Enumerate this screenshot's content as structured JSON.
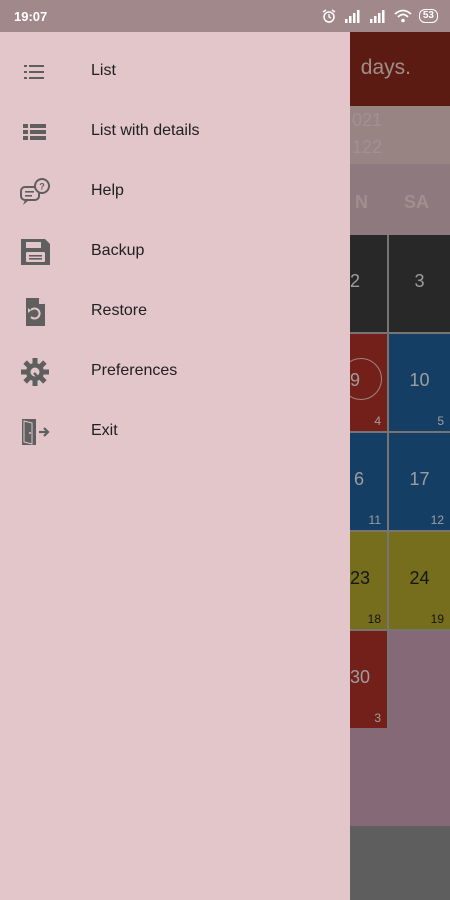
{
  "status_bar": {
    "time": "19:07",
    "battery": "53"
  },
  "app": {
    "title_fragment": "days.",
    "month_line1": "021",
    "month_line2": "122",
    "weekdays": [
      "N",
      "SA"
    ],
    "calendar": [
      {
        "num": "2",
        "sub": ""
      },
      {
        "num": "3",
        "sub": ""
      },
      {
        "num": "9",
        "sub": "4"
      },
      {
        "num": "10",
        "sub": "5"
      },
      {
        "num": "6",
        "sub": "11"
      },
      {
        "num": "17",
        "sub": "12"
      },
      {
        "num": "23",
        "sub": "18"
      },
      {
        "num": "24",
        "sub": "19"
      },
      {
        "num": "30",
        "sub": "3"
      }
    ]
  },
  "drawer": {
    "items": [
      {
        "label": "List",
        "icon": "list-icon"
      },
      {
        "label": "List with details",
        "icon": "list-details-icon"
      },
      {
        "label": "Help",
        "icon": "help-chat-icon"
      },
      {
        "label": "Backup",
        "icon": "save-icon"
      },
      {
        "label": "Restore",
        "icon": "restore-icon"
      },
      {
        "label": "Preferences",
        "icon": "gear-icon"
      },
      {
        "label": "Exit",
        "icon": "exit-door-icon"
      }
    ]
  },
  "colors": {
    "drawer_bg": "#e2c6ca",
    "status_bar_bg": "#a0888b",
    "header_bg": "#8b2a1c",
    "icon": "#5f5f5f"
  }
}
